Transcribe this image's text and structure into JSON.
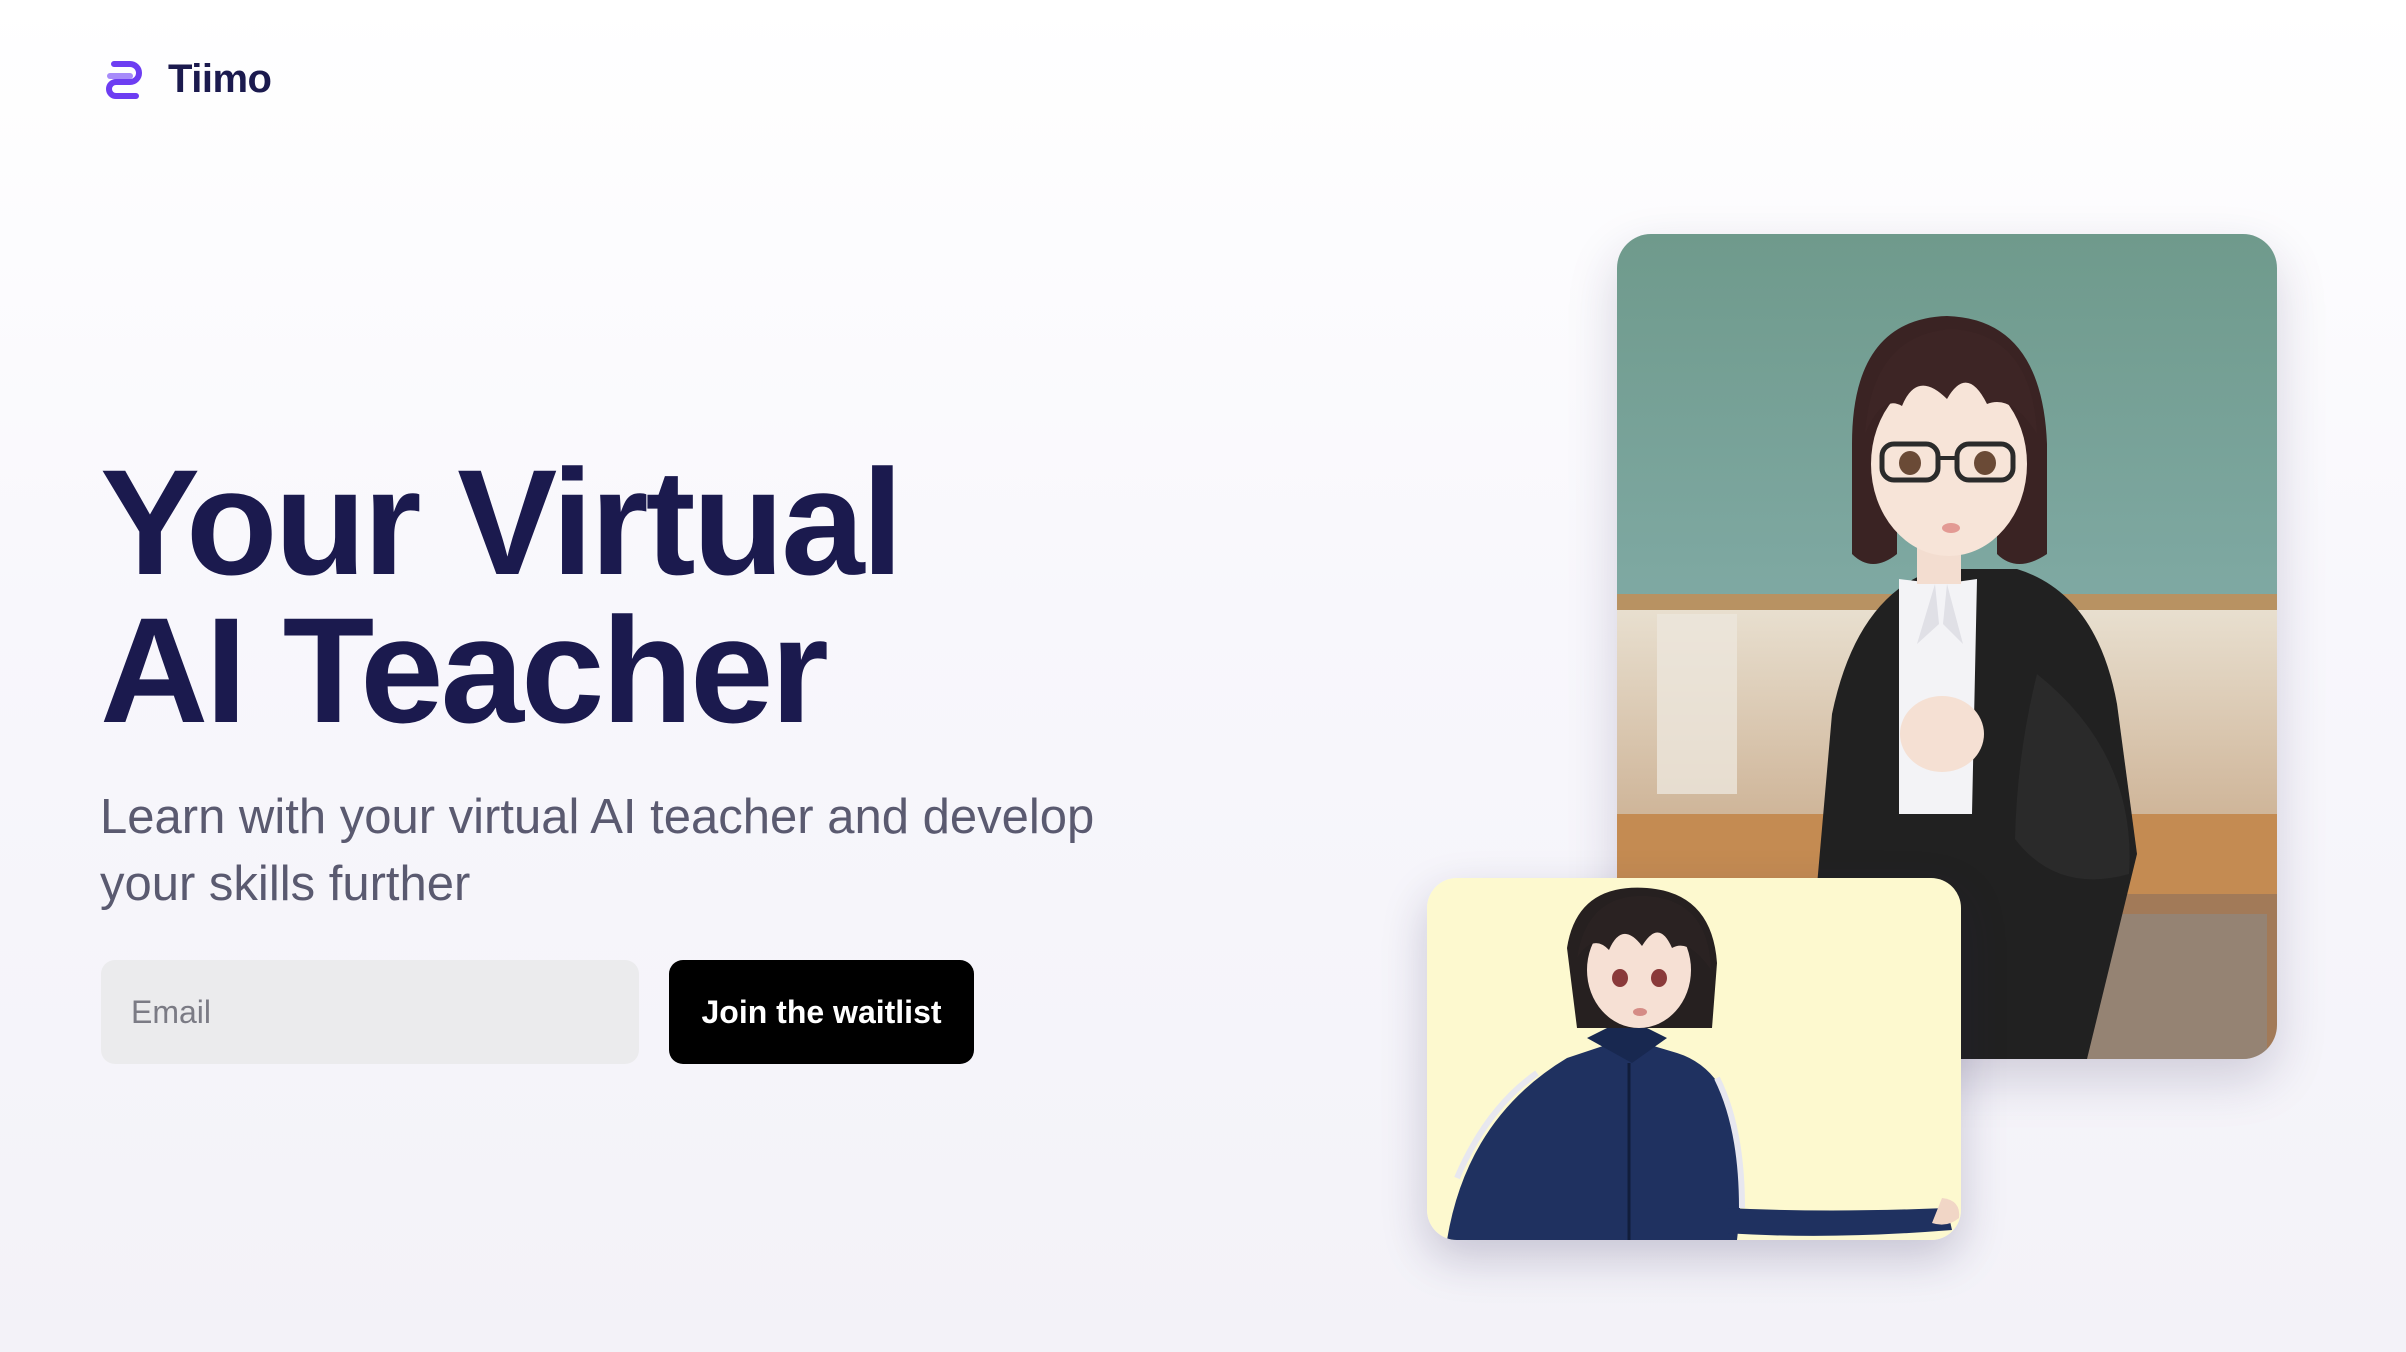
{
  "brand": {
    "name": "Tiimo",
    "accent_color": "#6d3df2"
  },
  "hero": {
    "title_line1": "Your Virtual",
    "title_line2": "AI Teacher",
    "subtitle": "Learn with your virtual AI teacher and develop your skills further"
  },
  "form": {
    "email_placeholder": "Email",
    "email_value": "",
    "submit_label": "Join the waitlist"
  },
  "media": {
    "main_video": "female-teacher-avatar-classroom",
    "pip_video": "male-student-avatar"
  },
  "colors": {
    "title": "#1b1a4e",
    "subtitle": "#5a5a70",
    "button_bg": "#000000",
    "button_text": "#ffffff",
    "input_bg": "#ebebed"
  }
}
